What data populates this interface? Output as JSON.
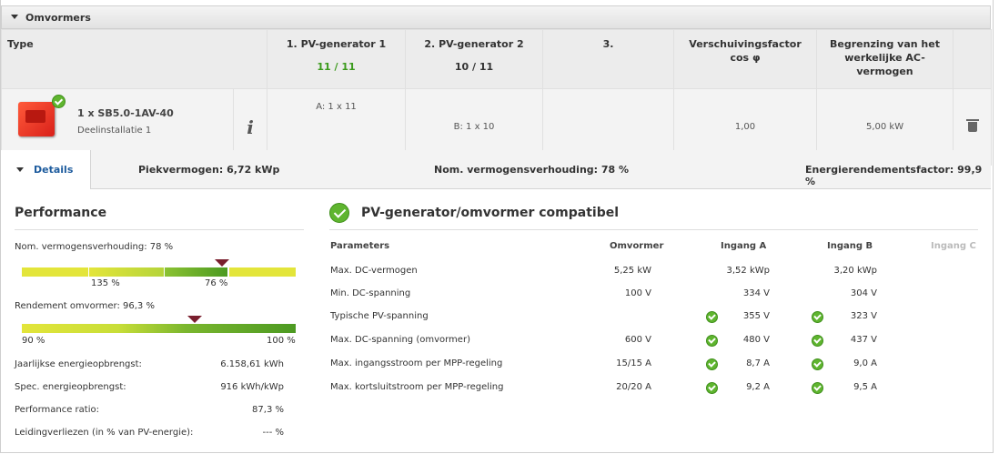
{
  "section": {
    "title": "Omvormers"
  },
  "table": {
    "headers": {
      "type": "Type",
      "pv1": "1. PV-generator 1",
      "pv1_value": "11 / 11",
      "pv2": "2. PV-generator 2",
      "pv2_value": "10 / 11",
      "pv3": "3.",
      "cos": "Verschuivingsfactor cos φ",
      "limit": "Begrenzing van het werkelijke AC-vermogen"
    },
    "row": {
      "name": "1 x SB5.0-1AV-40",
      "subtitle": "Deelinstallatie 1",
      "info": "i",
      "pv1": "A: 1 x 11",
      "pv2": "B: 1 x 10",
      "pv3": "",
      "cos": "1,00",
      "limit": "5,00 kW"
    }
  },
  "details": {
    "tab": "Details",
    "peak": "Piekvermogen: 6,72 kWp",
    "ratio": "Nom. vermogensverhouding: 78 %",
    "energy": "Energierendementsfactor: 99,9 %"
  },
  "performance": {
    "title": "Performance",
    "nom_label": "Nom. vermogensverhouding: 78 %",
    "nom_bar": {
      "tick_left": "135 %",
      "tick_right": "76 %",
      "marker_fraction": 0.73
    },
    "eff_label": "Rendement omvormer: 96,3 %",
    "eff_bar": {
      "min": "90 %",
      "max": "100 %",
      "marker_fraction": 0.63
    },
    "rows": [
      {
        "label": "Jaarlijkse energieopbrengst:",
        "value": "6.158,61 kWh"
      },
      {
        "label": "Spec. energieopbrengst:",
        "value": "916 kWh/kWp"
      },
      {
        "label": "Performance ratio:",
        "value": "87,3 %"
      },
      {
        "label": "Leidingverliezen (in % van PV-energie):",
        "value": "--- %"
      }
    ],
    "colors": {
      "yellow": "#e3e53a",
      "green": "#5aa52a",
      "marker": "#7a1f2e"
    }
  },
  "compat": {
    "title": "PV-generator/omvormer compatibel",
    "headers": [
      "Parameters",
      "Omvormer",
      "Ingang A",
      "Ingang B",
      "Ingang C"
    ],
    "rows": [
      {
        "param": "Max. DC-vermogen",
        "inv": "5,25 kW",
        "a": "3,52 kWp",
        "b": "3,20 kWp",
        "check": false
      },
      {
        "param": "Min. DC-spanning",
        "inv": "100 V",
        "a": "334 V",
        "b": "304 V",
        "check": false
      },
      {
        "param": "Typische PV-spanning",
        "inv": "",
        "a": "355 V",
        "b": "323 V",
        "check": true
      },
      {
        "param": "Max. DC-spanning (omvormer)",
        "inv": "600 V",
        "a": "480 V",
        "b": "437 V",
        "check": true
      },
      {
        "param": "Max. ingangsstroom per MPP-regeling",
        "inv": "15/15 A",
        "a": "8,7 A",
        "b": "9,0 A",
        "check": true
      },
      {
        "param": "Max. kortsluitstroom per MPP-regeling",
        "inv": "20/20 A",
        "a": "9,2 A",
        "b": "9,5 A",
        "check": true
      }
    ]
  }
}
